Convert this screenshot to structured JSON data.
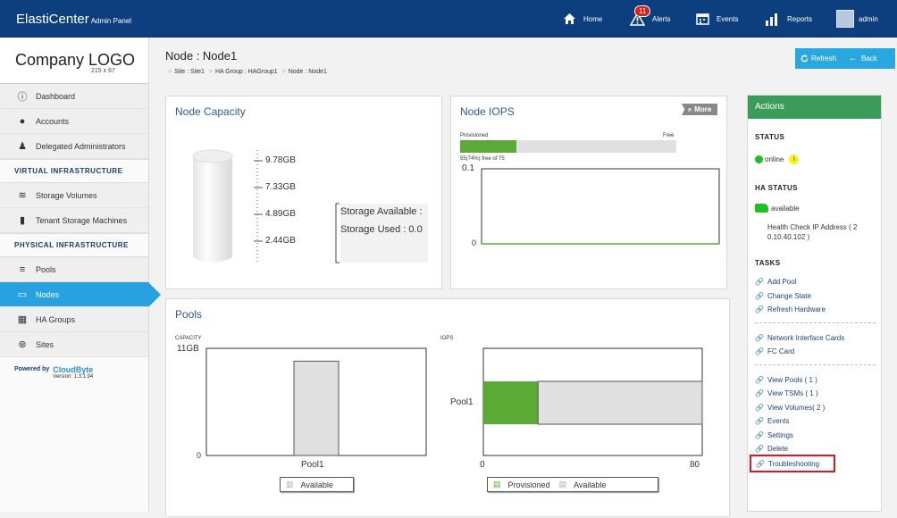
{
  "header": {
    "brand": "ElastiCenter",
    "brand_sub": "Admin Panel",
    "nav": {
      "home": "Home",
      "alerts": "Alerts",
      "alerts_count": "11",
      "events": "Events",
      "reports": "Reports",
      "user": "admin"
    }
  },
  "sidebar": {
    "logo": "Company LOGO",
    "logo_size": "215 x 67",
    "items": {
      "dashboard": "Dashboard",
      "accounts": "Accounts",
      "delegated": "Delegated Administrators",
      "section_virtual": "VIRTUAL INFRASTRUCTURE",
      "storage_volumes": "Storage Volumes",
      "tsm": "Tenant Storage Machines",
      "section_physical": "PHYSICAL INFRASTRUCTURE",
      "pools": "Pools",
      "nodes": "Nodes",
      "ha_groups": "HA Groups",
      "sites": "Sites"
    },
    "powered_by": "Powered by",
    "cloudbyte": "CloudByte",
    "version": "Version: 1.3.1.94"
  },
  "page": {
    "title": "Node : Node1",
    "breadcrumb": [
      "Site : Site1",
      "HA Group : HAGroup1",
      "Node : Node1"
    ],
    "refresh": "Refresh",
    "back": "Back"
  },
  "capacity": {
    "title": "Node Capacity",
    "ticks": [
      "9.78GB",
      "7.33GB",
      "4.89GB",
      "2.44GB"
    ],
    "storage_available": "Storage Available :",
    "storage_used": "Storage Used : 0.0"
  },
  "iops": {
    "title": "Node IOPS",
    "more": "More",
    "provisioned": "Provisioned",
    "free": "Free",
    "provisioned_fraction": 0.26,
    "note": "55(74%) free of 75",
    "ymax": "0.1",
    "ymin": "0"
  },
  "pools": {
    "title": "Pools",
    "capacity_label": "CAPACITY",
    "iops_label": "IOPS",
    "chart_data": [
      {
        "type": "bar",
        "title": "",
        "ylabel": "CAPACITY",
        "categories": [
          "Pool1"
        ],
        "series": [
          {
            "name": "Available",
            "values": [
              11
            ]
          }
        ],
        "ylim_labels": [
          "0",
          "11GB"
        ],
        "ylim": [
          0,
          12.5
        ]
      },
      {
        "type": "bar",
        "orientation": "horizontal",
        "title": "",
        "ylabel": "IOPS",
        "categories": [
          "Pool1"
        ],
        "series": [
          {
            "name": "Provisioned",
            "values": [
              20
            ]
          },
          {
            "name": "Available",
            "values": [
              60
            ]
          }
        ],
        "xlim": [
          0,
          80
        ],
        "xtick_labels": [
          "0",
          "80"
        ]
      }
    ],
    "legend_available": "Available",
    "legend_provisioned": "Provisioned",
    "legend_available2": "Available",
    "colors": {
      "provisioned": "#5aaa35",
      "available": "#e0e0e0"
    }
  },
  "actions": {
    "header": "Actions",
    "status_h": "STATUS",
    "status": "online",
    "ha_status_h": "HA STATUS",
    "ha_status": "available",
    "health_check": "Health Check IP Address ( 2",
    "health_check_ip": "0.10.40.102 )",
    "tasks_h": "TASKS",
    "tasks": [
      "Add Pool",
      "Change State",
      "Refresh Hardware"
    ],
    "tasks2": [
      "Network Interface Cards",
      "FC Card"
    ],
    "tasks3": [
      "View Pools ( 1 )",
      "View TSMs ( 1 )",
      "View Volumes( 2 )",
      "Events",
      "Settings",
      "Delete"
    ],
    "troubleshooting": "Troubleshooting"
  }
}
